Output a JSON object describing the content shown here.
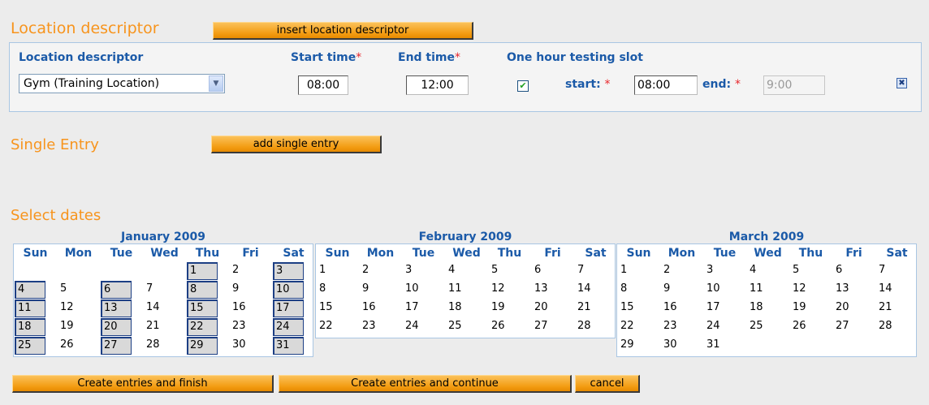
{
  "location": {
    "section_title": "Location descriptor",
    "insert_button": "insert location descriptor",
    "col_location": "Location descriptor",
    "col_start": "Start time",
    "col_end": "End time",
    "col_slot": "One hour testing slot",
    "required_mark": "*",
    "location_value": "Gym (Training Location)",
    "start_value": "08:00",
    "end_value": "12:00",
    "slot_checked": true,
    "slot_start_label": "start:",
    "slot_start_value": "08:00",
    "slot_end_label": "end:",
    "slot_end_value": "9:00"
  },
  "single_entry": {
    "title": "Single Entry",
    "button": "add single entry"
  },
  "dates": {
    "title": "Select dates",
    "weekdays": [
      "Sun",
      "Mon",
      "Tue",
      "Wed",
      "Thu",
      "Fri",
      "Sat"
    ],
    "months": [
      {
        "title": "January 2009",
        "weeks": [
          [
            "",
            "",
            "",
            "",
            "1",
            "2",
            "3"
          ],
          [
            "4",
            "5",
            "6",
            "7",
            "8",
            "9",
            "10"
          ],
          [
            "11",
            "12",
            "13",
            "14",
            "15",
            "16",
            "17"
          ],
          [
            "18",
            "19",
            "20",
            "21",
            "22",
            "23",
            "24"
          ],
          [
            "25",
            "26",
            "27",
            "28",
            "29",
            "30",
            "31"
          ]
        ],
        "selected": [
          "1",
          "3",
          "4",
          "6",
          "8",
          "10",
          "11",
          "13",
          "15",
          "17",
          "18",
          "20",
          "22",
          "24",
          "25",
          "27",
          "29",
          "31"
        ]
      },
      {
        "title": "February 2009",
        "weeks": [
          [
            "1",
            "2",
            "3",
            "4",
            "5",
            "6",
            "7"
          ],
          [
            "8",
            "9",
            "10",
            "11",
            "12",
            "13",
            "14"
          ],
          [
            "15",
            "16",
            "17",
            "18",
            "19",
            "20",
            "21"
          ],
          [
            "22",
            "23",
            "24",
            "25",
            "26",
            "27",
            "28"
          ]
        ],
        "selected": []
      },
      {
        "title": "March 2009",
        "weeks": [
          [
            "1",
            "2",
            "3",
            "4",
            "5",
            "6",
            "7"
          ],
          [
            "8",
            "9",
            "10",
            "11",
            "12",
            "13",
            "14"
          ],
          [
            "15",
            "16",
            "17",
            "18",
            "19",
            "20",
            "21"
          ],
          [
            "22",
            "23",
            "24",
            "25",
            "26",
            "27",
            "28"
          ],
          [
            "29",
            "30",
            "31",
            "",
            "",
            "",
            ""
          ]
        ],
        "selected": []
      }
    ]
  },
  "actions": {
    "finish": "Create entries and finish",
    "continue": "Create entries and continue",
    "cancel": "cancel"
  }
}
